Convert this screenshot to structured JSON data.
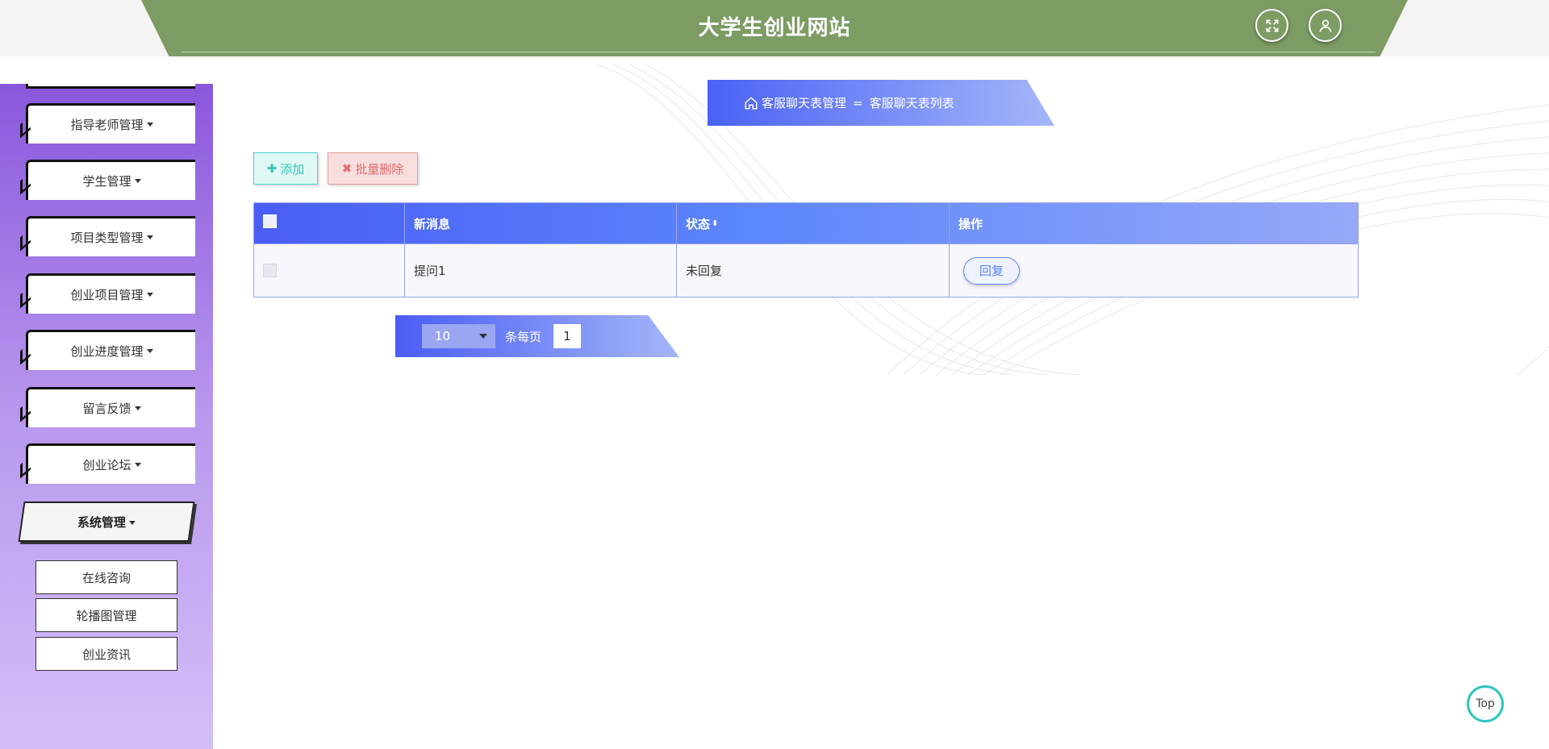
{
  "header": {
    "site_title": "大学生创业网站",
    "fullscreen_icon": "fullscreen-icon",
    "user_icon": "user-icon"
  },
  "sidebar": {
    "items": [
      {
        "label": "指导老师管理"
      },
      {
        "label": "学生管理"
      },
      {
        "label": "项目类型管理"
      },
      {
        "label": "创业项目管理"
      },
      {
        "label": "创业进度管理"
      },
      {
        "label": "留言反馈"
      },
      {
        "label": "创业论坛"
      }
    ],
    "active_item": {
      "label": "系统管理"
    },
    "sub_items": [
      {
        "label": "在线咨询"
      },
      {
        "label": "轮播图管理"
      },
      {
        "label": "创业资讯"
      }
    ]
  },
  "breadcrumb": {
    "icon": "home-icon",
    "parent": "客服聊天表管理",
    "separator": "=",
    "current": "客服聊天表列表"
  },
  "toolbar": {
    "add_label": "添加",
    "add_icon": "plus-icon",
    "batch_delete_label": "批量删除",
    "batch_delete_icon": "x-icon"
  },
  "table": {
    "headers": [
      "新消息",
      "状态",
      "操作"
    ],
    "sort_icon": "⬍",
    "rows": [
      {
        "message": "提问1",
        "status": "未回复",
        "action": "回复"
      }
    ]
  },
  "pagination": {
    "page_size": "10",
    "per_page_label": "条每页",
    "current_page": "1"
  },
  "back_to_top": "Top",
  "colors": {
    "header_green": "#7c9c64",
    "primary_blue": "#4a5df5",
    "sidebar_purple": "#8a57dc",
    "add_teal": "#34c4b7",
    "delete_red": "#e36b6b"
  }
}
